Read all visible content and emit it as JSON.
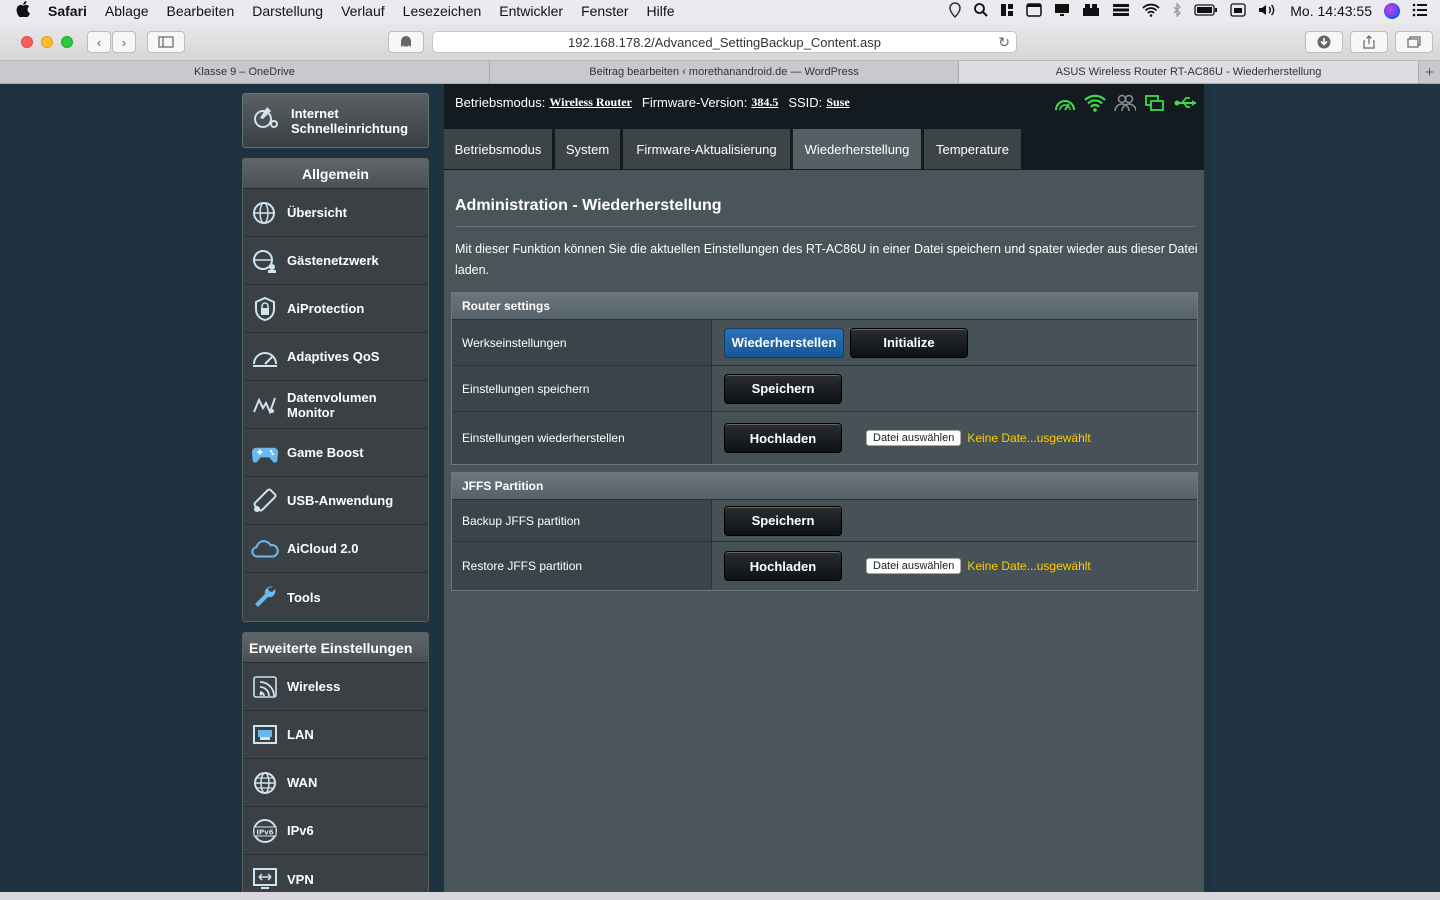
{
  "menubar": {
    "app": "Safari",
    "items": [
      "Ablage",
      "Bearbeiten",
      "Darstellung",
      "Verlauf",
      "Lesezeichen",
      "Entwickler",
      "Fenster",
      "Hilfe"
    ],
    "clock": "Mo. 14:43:55"
  },
  "toolbar": {
    "url": "192.168.178.2/Advanced_SettingBackup_Content.asp"
  },
  "tabs": [
    {
      "title": "Klasse 9 – OneDrive"
    },
    {
      "title": "Beitrag bearbeiten ‹ morethanandroid.de — WordPress"
    },
    {
      "title": "ASUS Wireless Router RT-AC86U - Wiederherstellung"
    }
  ],
  "router": {
    "qis_label_1": "Internet",
    "qis_label_2": "Schnelleinrichtung",
    "header": {
      "mode_label": "Betriebsmodus:",
      "mode_value": "Wireless Router",
      "fw_label": "Firmware-Version:",
      "fw_value": "384.5",
      "ssid_label": "SSID:",
      "ssid_value": "Suse"
    },
    "general": {
      "title": "Allgemein",
      "items": [
        {
          "label": "Übersicht",
          "icon": "globe-icon"
        },
        {
          "label": "Gästenetzwerk",
          "icon": "guest-network-icon"
        },
        {
          "label": "AiProtection",
          "icon": "shield-lock-icon"
        },
        {
          "label": "Adaptives QoS",
          "icon": "speedometer-icon"
        },
        {
          "label": "Datenvolumen",
          "label2": "Monitor",
          "icon": "traffic-monitor-icon"
        },
        {
          "label": "Game Boost",
          "icon": "gamepad-icon"
        },
        {
          "label": "USB-Anwendung",
          "icon": "usb-app-icon"
        },
        {
          "label": "AiCloud 2.0",
          "icon": "cloud-icon"
        },
        {
          "label": "Tools",
          "icon": "wrench-icon"
        }
      ]
    },
    "advanced": {
      "title": "Erweiterte Einstellungen",
      "items": [
        {
          "label": "Wireless",
          "icon": "wireless-icon"
        },
        {
          "label": "LAN",
          "icon": "lan-icon"
        },
        {
          "label": "WAN",
          "icon": "wan-globe-icon"
        },
        {
          "label": "IPv6",
          "icon": "ipv6-icon"
        },
        {
          "label": "VPN",
          "icon": "vpn-icon"
        }
      ]
    },
    "page_tabs": [
      "Betriebsmodus",
      "System",
      "Firmware-Aktualisierung",
      "Wiederherstellung",
      "Temperature"
    ],
    "title": "Administration - Wiederherstellung",
    "description": "Mit dieser Funktion können Sie die aktuellen Einstellungen des RT-AC86U in einer Datei speichern und spater wieder aus dieser Datei laden.",
    "router_settings": {
      "header": "Router settings",
      "rows": {
        "factory": {
          "label": "Werkseinstellungen",
          "btn1": "Wiederherstellen",
          "btn2": "Initialize"
        },
        "save": {
          "label": "Einstellungen speichern",
          "btn": "Speichern"
        },
        "restore": {
          "label": "Einstellungen wiederherstellen",
          "btn": "Hochladen",
          "file_btn": "Datei auswählen",
          "file_status": "Keine Date...usgewählt"
        }
      }
    },
    "jffs": {
      "header": "JFFS Partition",
      "rows": {
        "backup": {
          "label": "Backup JFFS partition",
          "btn": "Speichern"
        },
        "restore": {
          "label": "Restore JFFS partition",
          "btn": "Hochladen",
          "file_btn": "Datei auswählen",
          "file_status": "Keine Date...usgewählt"
        }
      }
    }
  },
  "colors": {
    "accent_green": "#3ddc4a",
    "file_status_yellow": "#ffcc00",
    "active_button_blue": "#2c72b8"
  }
}
